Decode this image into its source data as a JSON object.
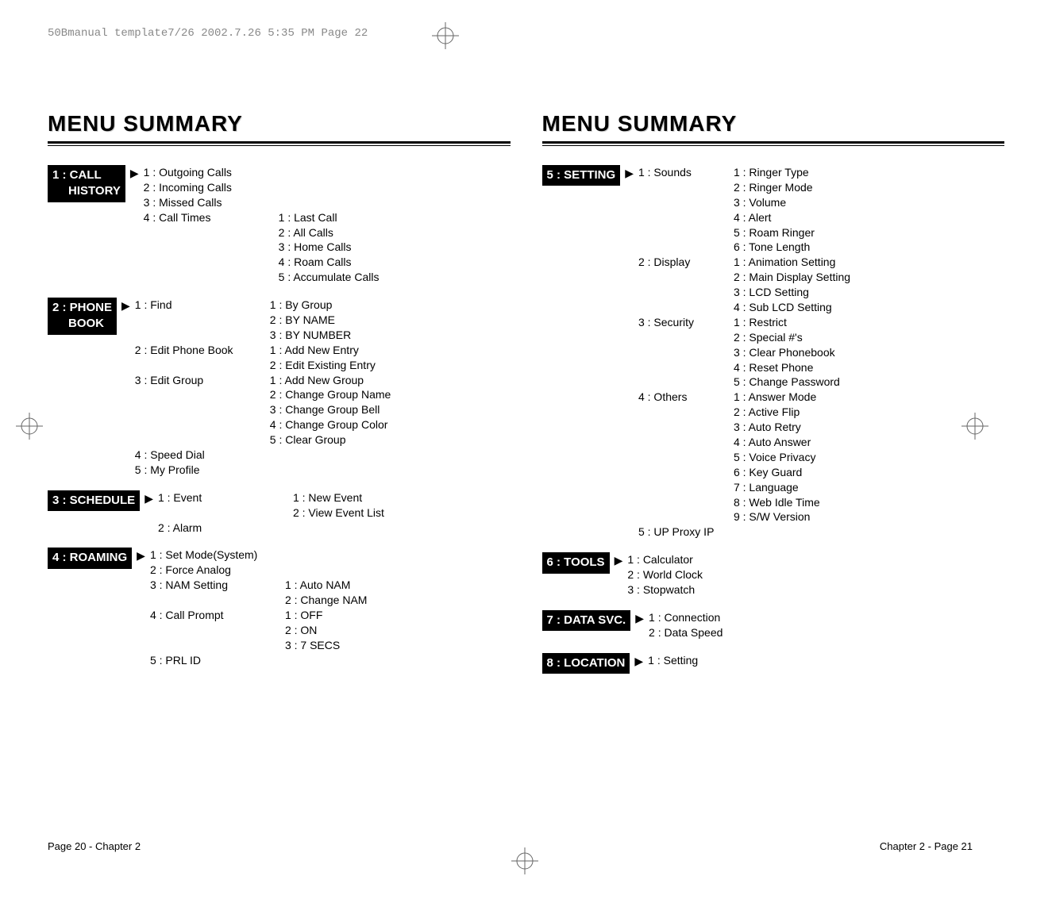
{
  "header_line": "50Bmanual template7/26  2002.7.26  5:35 PM  Page 22",
  "left": {
    "title": "MENU SUMMARY",
    "sections": {
      "call_history": {
        "badge_line1": "1 : CALL",
        "badge_line2": "HISTORY",
        "items": {
          "i1": "1 : Outgoing Calls",
          "i2": "2 : Incoming Calls",
          "i3": "3 : Missed Calls",
          "i4": "4 : Call Times",
          "i4_sub": {
            "s1": "1 :  Last Call",
            "s2": "2 :  All Calls",
            "s3": "3 :  Home Calls",
            "s4": "4 :  Roam Calls",
            "s5": "5 :  Accumulate Calls"
          }
        }
      },
      "phone_book": {
        "badge_line1": "2 : PHONE",
        "badge_line2": "BOOK",
        "items": {
          "i1": "1 : Find",
          "i1_sub": {
            "s1": "1 :  By Group",
            "s2": "2 :  BY NAME",
            "s3": "3 :  BY NUMBER"
          },
          "i2": "2 : Edit Phone Book",
          "i2_sub": {
            "s1": "1 :  Add New Entry",
            "s2": "2 :  Edit Existing Entry"
          },
          "i3": "3 : Edit Group",
          "i3_sub": {
            "s1": "1 :  Add New Group",
            "s2": "2 :  Change Group Name",
            "s3": "3 :  Change Group Bell",
            "s4": "4 :  Change Group Color",
            "s5": "5 :  Clear Group"
          },
          "i4": "4 : Speed Dial",
          "i5": "5 : My Profile"
        }
      },
      "schedule": {
        "badge": "3 : SCHEDULE",
        "items": {
          "i1": "1 : Event",
          "i1_sub": {
            "s1": "1 :  New Event",
            "s2": "2 :  View Event List"
          },
          "i2": "2 : Alarm"
        }
      },
      "roaming": {
        "badge": "4 : ROAMING",
        "items": {
          "i1": "1 : Set Mode(System)",
          "i2": "2 : Force Analog",
          "i3": "3 : NAM Setting",
          "i3_sub": {
            "s1": "1 :  Auto NAM",
            "s2": "2 :  Change NAM"
          },
          "i4": "4 : Call Prompt",
          "i4_sub": {
            "s1": "1 :  OFF",
            "s2": "2 :  ON",
            "s3": "3 :  7 SECS"
          },
          "i5": "5 : PRL ID"
        }
      }
    },
    "footer": "Page 20 - Chapter 2"
  },
  "right": {
    "title": "MENU SUMMARY",
    "sections": {
      "setting": {
        "badge": "5 : SETTING",
        "items": {
          "i1": "1 : Sounds",
          "i1_sub": {
            "s1": "1 : Ringer Type",
            "s2": "2 : Ringer Mode",
            "s3": "3 : Volume",
            "s4": "4 : Alert",
            "s5": "5 : Roam Ringer",
            "s6": "6 : Tone Length"
          },
          "i2": "2 : Display",
          "i2_sub": {
            "s1": "1 : Animation Setting",
            "s2": "2 : Main Display Setting",
            "s3": "3 : LCD Setting",
            "s4": "4 : Sub LCD Setting"
          },
          "i3": "3 : Security",
          "i3_sub": {
            "s1": "1 : Restrict",
            "s2": "2 : Special #'s",
            "s3": "3 : Clear Phonebook",
            "s4": "4 : Reset Phone",
            "s5": "5 : Change Password"
          },
          "i4": "4 : Others",
          "i4_sub": {
            "s1": "1 : Answer Mode",
            "s2": "2 : Active Flip",
            "s3": "3 : Auto Retry",
            "s4": "4 : Auto Answer",
            "s5": "5 : Voice Privacy",
            "s6": "6 : Key Guard",
            "s7": "7 : Language",
            "s8": "8 : Web Idle Time",
            "s9": "9 : S/W Version"
          },
          "i5": "5 : UP Proxy IP"
        }
      },
      "tools": {
        "badge": "6 : TOOLS",
        "items": {
          "i1": "1 : Calculator",
          "i2": "2 : World Clock",
          "i3": "3 : Stopwatch"
        }
      },
      "data_svc": {
        "badge": "7 : DATA SVC.",
        "items": {
          "i1": "1 : Connection",
          "i2": "2 : Data Speed"
        }
      },
      "location": {
        "badge": "8 : LOCATION",
        "items": {
          "i1": "1 : Setting"
        }
      }
    },
    "footer": "Chapter 2 - Page 21"
  }
}
